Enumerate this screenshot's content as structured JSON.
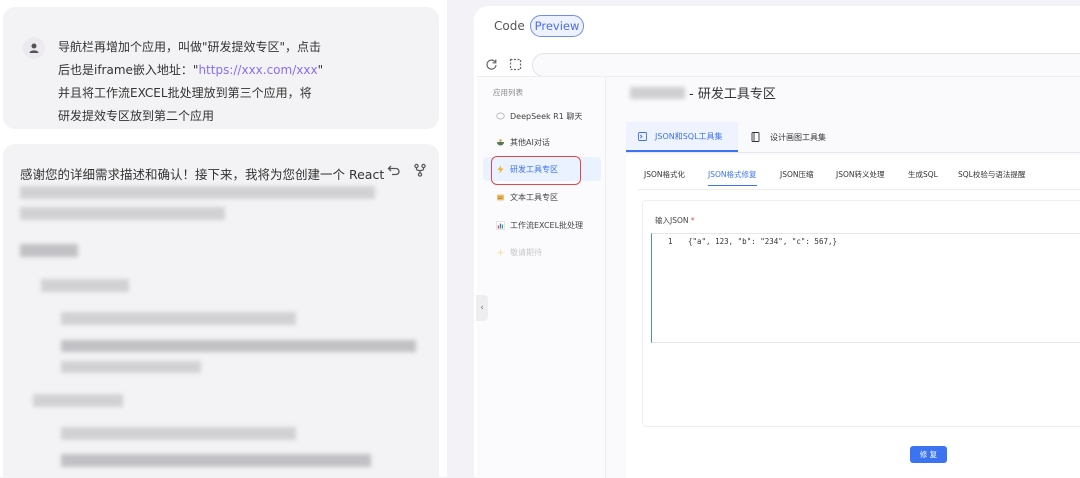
{
  "chat": {
    "user_lines": [
      "导航栏再增加个应用，叫做\"研发提效专区\"，点击",
      "后也是iframe嵌入地址：",
      "并且将工作流EXCEL批处理放到第三个应用，将",
      "研发提效专区放到第二个应用"
    ],
    "user_link_prefix": "后也是iframe嵌入地址：\"",
    "user_link": "https://xxx.com/xxx",
    "user_link_suffix": "\"",
    "assistant_first_line": "感谢您的详细需求描述和确认！接下来，我将为您创建一个 React"
  },
  "preview_panel": {
    "tab_code": "Code",
    "tab_preview": "Preview"
  },
  "app": {
    "sidebar_title": "应用列表",
    "nav": [
      {
        "label": "DeepSeek R1 聊天",
        "icon": "chat-bubble-icon"
      },
      {
        "label": "其他AI对话",
        "icon": "bowl-icon"
      },
      {
        "label": "研发工具专区",
        "icon": "lightning-icon"
      },
      {
        "label": "文本工具专区",
        "icon": "note-icon"
      },
      {
        "label": "工作流EXCEL批处理",
        "icon": "bar-chart-icon"
      },
      {
        "label": "敬请期待",
        "icon": "sparkle-icon"
      }
    ],
    "page_title": "- 研发工具专区",
    "top_tabs": [
      {
        "label": "JSON和SQL工具集",
        "icon": "terminal-icon"
      },
      {
        "label": "设计画图工具集",
        "icon": "doc-icon"
      }
    ],
    "sub_tabs": [
      "JSON格式化",
      "JSON格式修复",
      "JSON压缩",
      "JSON转义处理",
      "生成SQL",
      "SQL校验与语法提醒"
    ],
    "field_label": "输入JSON",
    "field_required": "*",
    "editor_line": "1",
    "editor_code": "{\"a\", 123, \"b\": \"234\", \"c\": 567,}",
    "fix_button": "修 复"
  },
  "colors": {
    "accent": "#3b73f0",
    "highlight_border": "#e24a4a",
    "link": "#8b6cf0"
  }
}
